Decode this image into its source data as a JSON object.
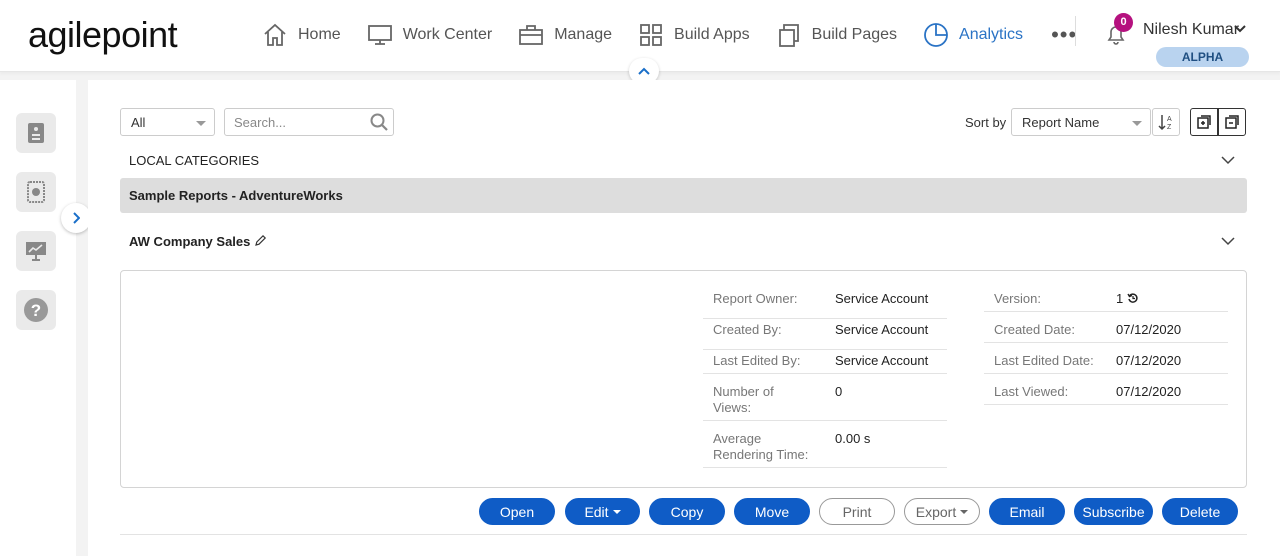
{
  "brand": {
    "logo_text": "agilepoint"
  },
  "nav": {
    "items": [
      {
        "label": "Home",
        "icon": "home-icon"
      },
      {
        "label": "Work Center",
        "icon": "monitor-icon"
      },
      {
        "label": "Manage",
        "icon": "briefcase-icon"
      },
      {
        "label": "Build Apps",
        "icon": "grid-icon"
      },
      {
        "label": "Build Pages",
        "icon": "pages-icon"
      },
      {
        "label": "Analytics",
        "icon": "pie-chart-icon",
        "active": true
      }
    ],
    "more_label": "•••"
  },
  "notifications": {
    "count": "0"
  },
  "user": {
    "name": "Nilesh Kumar",
    "environment": "ALPHA"
  },
  "toolbar": {
    "filter_value": "All",
    "search_placeholder": "Search...",
    "sort_label": "Sort by",
    "sort_value": "Report Name"
  },
  "categories": {
    "local_title": "LOCAL CATEGORIES",
    "selected": "Sample Reports - AdventureWorks"
  },
  "report": {
    "title": "AW Company Sales",
    "props_left": [
      {
        "key": "Report Owner:",
        "value": "Service Account"
      },
      {
        "key": "Created By:",
        "value": "Service Account"
      },
      {
        "key": "Last Edited By:",
        "value": "Service Account"
      },
      {
        "key": "Number of Views:",
        "value": "0"
      },
      {
        "key": "Average Rendering Time:",
        "value": "0.00 s"
      }
    ],
    "props_right": [
      {
        "key": "Version:",
        "value": "1"
      },
      {
        "key": "Created Date:",
        "value": "07/12/2020"
      },
      {
        "key": "Last Edited Date:",
        "value": "07/12/2020"
      },
      {
        "key": "Last Viewed:",
        "value": "07/12/2020"
      }
    ]
  },
  "actions": {
    "open": "Open",
    "edit": "Edit",
    "copy": "Copy",
    "move": "Move",
    "print": "Print",
    "export": "Export",
    "email": "Email",
    "subscribe": "Subscribe",
    "delete": "Delete"
  },
  "colors": {
    "accent": "#0f5cc6",
    "nav_active": "#2a73c5",
    "badge": "#b5117f",
    "env_badge": "#b9d3ef"
  }
}
